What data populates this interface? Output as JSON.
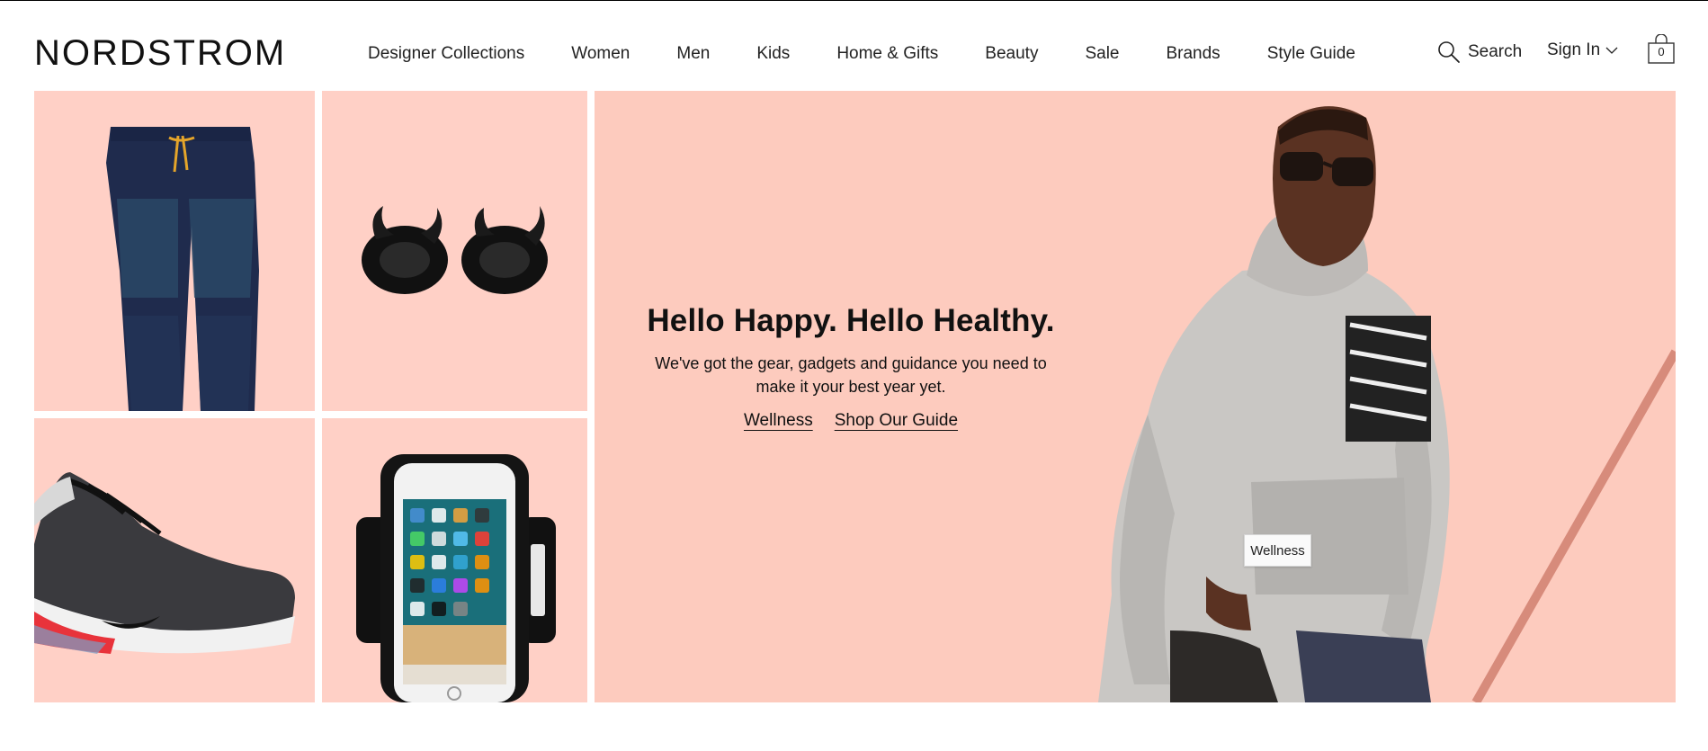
{
  "brand": {
    "logo_text": "NORDSTROM"
  },
  "nav": {
    "items": [
      "Designer Collections",
      "Women",
      "Men",
      "Kids",
      "Home & Gifts",
      "Beauty",
      "Sale",
      "Brands",
      "Style Guide"
    ]
  },
  "utility": {
    "search_label": "Search",
    "signin_label": "Sign In",
    "bag_count": "0",
    "search_icon": "magnifier-icon",
    "signin_icon": "chevron-down-icon",
    "bag_icon": "shopping-bag-icon"
  },
  "tiles": [
    {
      "product": "jogger pants"
    },
    {
      "product": "wireless earbuds"
    },
    {
      "product": "running sneaker"
    },
    {
      "product": "phone armband"
    }
  ],
  "hero": {
    "title": "Hello Happy. Hello Healthy.",
    "subtitle": "We've got the gear, gadgets and guidance you need to make it your best year yet.",
    "links": [
      "Wellness",
      "Shop Our Guide"
    ],
    "tag_label": "Wellness"
  },
  "colors": {
    "tile_background": "#ffd0c6",
    "hero_background": "#fdcbbe",
    "text": "#111111"
  }
}
